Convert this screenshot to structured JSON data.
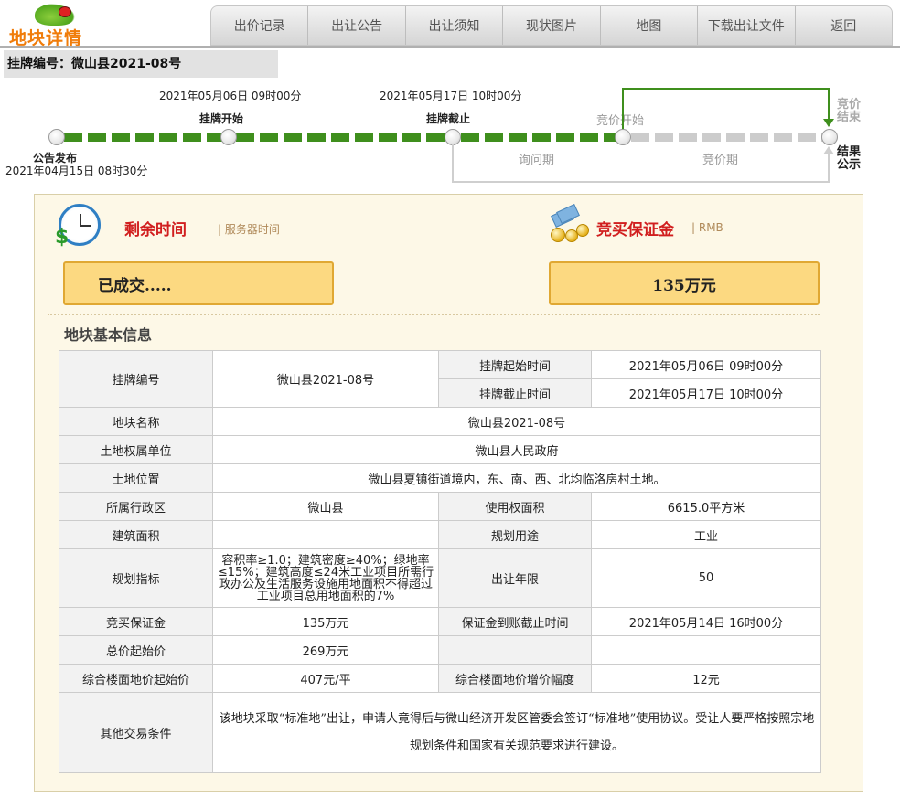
{
  "logo_text": "地块详情",
  "nav": [
    "出价记录",
    "出让公告",
    "出让须知",
    "现状图片",
    "地图",
    "下载出让文件",
    "返回"
  ],
  "parcel_heading": "挂牌编号：微山县2021-08号",
  "timeline": {
    "listing_start_date": "2021年05月06日 09时00分",
    "listing_end_date": "2021年05月17日 10时00分",
    "announce_date": "2021年04月15日 08时30分",
    "announce_label": "公告发布",
    "listing_start_label": "挂牌开始",
    "listing_end_label": "挂牌截止",
    "bid_start_label": "竞价开始",
    "bid_end_label_1": "竞价",
    "bid_end_label_2": "结束",
    "result_label_1": "结果",
    "result_label_2": "公示",
    "inquiry_period": "询问期",
    "bidding_period": "竞价期"
  },
  "remaining": {
    "title": "剩余时间",
    "sub": "| 服务器时间",
    "status": "已成交....."
  },
  "deposit": {
    "title": "竞买保证金",
    "sub": "| RMB",
    "value": "135万元"
  },
  "info_title": "地块基本信息",
  "table": {
    "parcel_no_label": "挂牌编号",
    "parcel_no_value": "微山县2021-08号",
    "listing_start_label": "挂牌起始时间",
    "listing_start_value": "2021年05月06日 09时00分",
    "listing_end_label": "挂牌截止时间",
    "listing_end_value": "2021年05月17日 10时00分",
    "name_label": "地块名称",
    "name_value": "微山县2021-08号",
    "owner_label": "土地权属单位",
    "owner_value": "微山县人民政府",
    "location_label": "土地位置",
    "location_value": "微山县夏镇街道境内，东、南、西、北均临洛房村土地。",
    "district_label": "所属行政区",
    "district_value": "微山县",
    "area_label": "使用权面积",
    "area_value": "6615.0平方米",
    "building_area_label": "建筑面积",
    "building_area_value": "",
    "usage_label": "规划用途",
    "usage_value": "工业",
    "plan_label": "规划指标",
    "plan_value": "容积率≥1.0；建筑密度≥40%；绿地率≤15%；建筑高度≤24米工业项目所需行政办公及生活服务设施用地面积不得超过工业项目总用地面积的7%",
    "term_label": "出让年限",
    "term_value": "50",
    "deposit_label": "竞买保证金",
    "deposit_value": "135万元",
    "deposit_deadline_label": "保证金到账截止时间",
    "deposit_deadline_value": "2021年05月14日 16时00分",
    "start_price_label": "总价起始价",
    "start_price_value": "269万元",
    "floor_price_label": "综合楼面地价起始价",
    "floor_price_value": "407元/平",
    "increment_label": "综合楼面地价增价幅度",
    "increment_value": "12元",
    "other_label": "其他交易条件",
    "other_value": "该地块采取“标准地”出让，申请人竟得后与微山经济开发区管委会签订“标准地”使用协议。受让人要严格按照宗地规划条件和国家有关规范要求进行建设。"
  }
}
